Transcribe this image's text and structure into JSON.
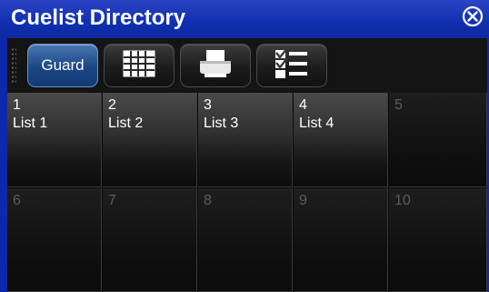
{
  "window": {
    "title": "Cuelist Directory"
  },
  "toolbar": {
    "guard_label": "Guard"
  },
  "icons": {
    "close": "close-icon",
    "grid": "grid-view-icon",
    "print": "printer-icon",
    "checklist": "checklist-icon"
  },
  "cells": [
    {
      "num": "1",
      "name": "List 1"
    },
    {
      "num": "2",
      "name": "List 2"
    },
    {
      "num": "3",
      "name": "List 3"
    },
    {
      "num": "4",
      "name": "List 4"
    },
    {
      "num": "5",
      "name": ""
    },
    {
      "num": "6",
      "name": ""
    },
    {
      "num": "7",
      "name": ""
    },
    {
      "num": "8",
      "name": ""
    },
    {
      "num": "9",
      "name": ""
    },
    {
      "num": "10",
      "name": ""
    }
  ],
  "colors": {
    "titlebar": "#1130b2",
    "guard_button": "#1b4787",
    "empty_number": "#5c5c5c"
  }
}
